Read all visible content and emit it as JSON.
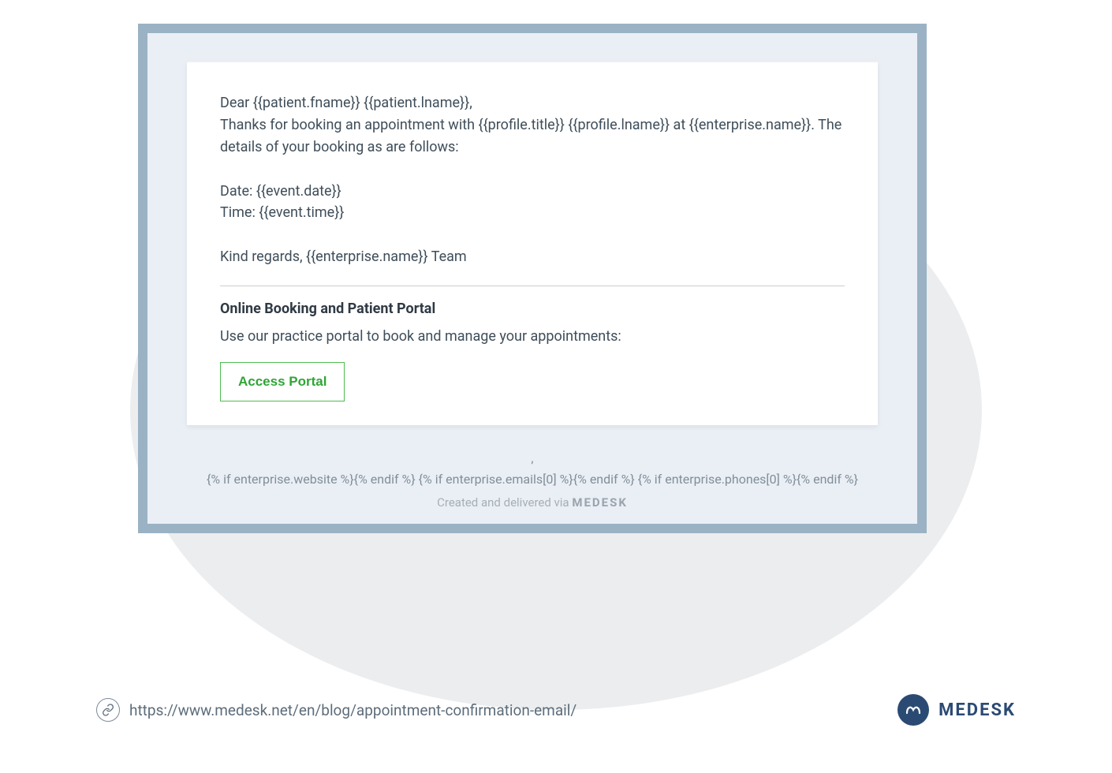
{
  "email": {
    "body": "Dear {{patient.fname}} {{patient.lname}},\nThanks for booking an appointment with {{profile.title}} {{profile.lname}} at {{enterprise.name}}. The details of your booking as are follows:\n\nDate: {{event.date}}\nTime: {{event.time}}\n\nKind regards, {{enterprise.name}} Team",
    "section_heading": "Online Booking and Patient Portal",
    "section_text": "Use our practice portal to book and manage your appointments:",
    "button_label": "Access Portal"
  },
  "footer": {
    "line1": ",",
    "line2": "{% if enterprise.website %}{% endif %} {% if enterprise.emails[0] %}{% endif %} {% if enterprise.phones[0] %}{% endif %}",
    "delivered_prefix": "Created and delivered via ",
    "delivered_brand": "MEDESK"
  },
  "source": {
    "url": "https://www.medesk.net/en/blog/appointment-confirmation-email/"
  },
  "brand": {
    "name": "MEDESK"
  }
}
